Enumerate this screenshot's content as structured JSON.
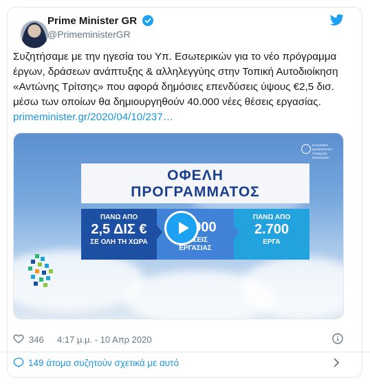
{
  "author": {
    "name": "Prime Minister GR",
    "handle": "@PrimeministerGR"
  },
  "tweet": {
    "text": "Συζητήσαμε με την ηγεσία του Υπ. Εσωτερικών για το νέο πρόγραμμα έργων, δράσεων ανάπτυξης & αλληλεγγύης στην Τοπική Αυτοδιοίκηση «Αντώνης Τρίτσης» που αφορά δημόσιες επενδύσεις ύψους €2,5 δισ. μέσω των οποίων θα δημιουργηθούν 40.000 νέες θέσεις εργασίας.",
    "link": "primeminister.gr/2020/04/10/237…"
  },
  "media": {
    "gov_label": "ΕΛΛΗΝΙΚΗ ΔΗΜΟΚΡΑΤΙΑ Υπουργείο Εσωτερικών",
    "banner_line1": "ΟΦΕΛΗ",
    "banner_line2": "ΠΡΟΓΡΑΜΜΑΤΟΣ",
    "box1": {
      "small": "ΠΑΝΩ ΑΠΟ",
      "big": "2,5 ΔΙΣ €",
      "sub": "ΣΕ ΟΛΗ ΤΗ ΧΩΡΑ"
    },
    "box2": {
      "small": "",
      "big": "40.000",
      "sub1": "ΘΕΣΕΙΣ",
      "sub2": "ΕΡΓΑΣΙΑΣ"
    },
    "box3": {
      "small": "ΠΑΝΩ ΑΠΟ",
      "big": "2.700",
      "sub": "ΕΡΓΑ"
    }
  },
  "footer": {
    "likes": "346",
    "timestamp": "4:17 μ.μ. - 10 Απρ 2020",
    "conversation": "149 άτομα συζητούν σχετικά με αυτό"
  },
  "colors": {
    "twitter_blue": "#1da1f2",
    "link_blue": "#1b95e0",
    "muted_gray": "#657786"
  }
}
